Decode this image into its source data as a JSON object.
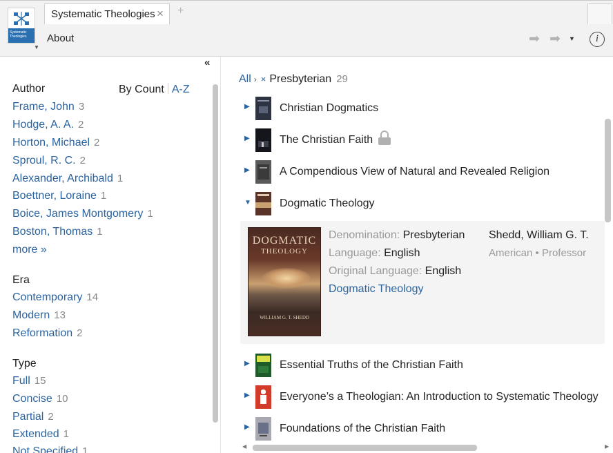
{
  "app": {
    "icon_name": "systematic-theologies-app-icon",
    "icon_label": "Systematic Theologies"
  },
  "tabs": [
    {
      "label": "Systematic Theologies",
      "active": true
    }
  ],
  "menu": {
    "about": "About"
  },
  "nav": {
    "back_icon": "arrow-left-icon",
    "forward_icon": "arrow-right-icon",
    "history_icon": "caret-down-icon",
    "info_icon": "info-icon",
    "info_glyph": "i"
  },
  "sidebar": {
    "collapse_glyph": "«",
    "author": {
      "heading": "Author",
      "sort_by_count": "By Count",
      "sort_az": "A-Z",
      "items": [
        {
          "label": "Frame, John",
          "count": "3"
        },
        {
          "label": "Hodge, A. A.",
          "count": "2"
        },
        {
          "label": "Horton, Michael",
          "count": "2"
        },
        {
          "label": "Sproul, R. C.",
          "count": "2"
        },
        {
          "label": "Alexander, Archibald",
          "count": "1"
        },
        {
          "label": "Boettner, Loraine",
          "count": "1"
        },
        {
          "label": "Boice, James Montgomery",
          "count": "1"
        },
        {
          "label": "Boston, Thomas",
          "count": "1"
        }
      ],
      "more": "more »"
    },
    "era": {
      "heading": "Era",
      "items": [
        {
          "label": "Contemporary",
          "count": "14"
        },
        {
          "label": "Modern",
          "count": "13"
        },
        {
          "label": "Reformation",
          "count": "2"
        }
      ]
    },
    "type": {
      "heading": "Type",
      "items": [
        {
          "label": "Full",
          "count": "15"
        },
        {
          "label": "Concise",
          "count": "10"
        },
        {
          "label": "Partial",
          "count": "2"
        },
        {
          "label": "Extended",
          "count": "1"
        },
        {
          "label": "Not Specified",
          "count": "1"
        }
      ]
    }
  },
  "main": {
    "breadcrumb": {
      "all": "All",
      "separator": "›",
      "remove": "×",
      "current": "Presbyterian",
      "count": "29"
    },
    "books": [
      {
        "title": "Christian Dogmatics",
        "expanded": false,
        "locked": false
      },
      {
        "title": "The Christian Faith",
        "expanded": false,
        "locked": true
      },
      {
        "title": "A Compendious View of Natural and Revealed Religion",
        "expanded": false,
        "locked": false
      },
      {
        "title": "Dogmatic Theology",
        "expanded": true,
        "locked": false
      },
      {
        "title": "Essential Truths of the Christian Faith",
        "expanded": false,
        "locked": false
      },
      {
        "title": "Everyone’s a Theologian: An Introduction to Systematic Theology",
        "expanded": false,
        "locked": false
      },
      {
        "title": "Foundations of the Christian Faith",
        "expanded": false,
        "locked": false
      }
    ],
    "detail": {
      "cover_title": "DOGMATIC",
      "cover_subtitle": "THEOLOGY",
      "cover_author": "WILLIAM G. T. SHEDD",
      "denomination_label": "Denomination:",
      "denomination": "Presbyterian",
      "language_label": "Language:",
      "language": "English",
      "original_language_label": "Original Language:",
      "original_language": "English",
      "link": "Dogmatic Theology",
      "author_name": "Shedd, William G. T.",
      "author_desc": "American • Professor"
    }
  },
  "colors": {
    "link": "#2a63a0",
    "count": "#888888",
    "detail_bg": "#f4f4f4"
  }
}
